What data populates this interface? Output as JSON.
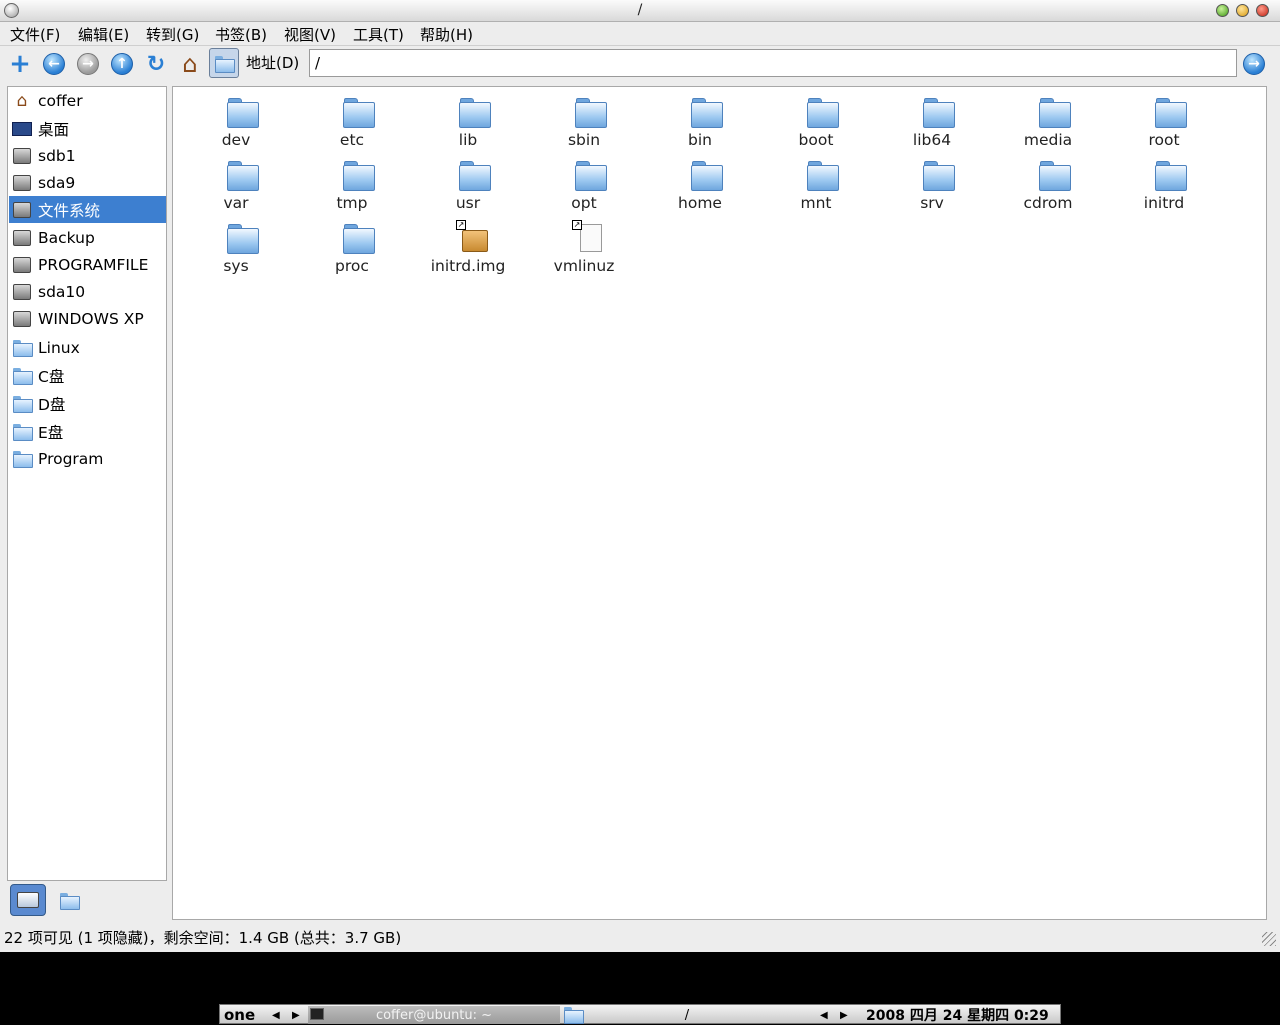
{
  "window": {
    "title": "/"
  },
  "menu": [
    "文件(F)",
    "编辑(E)",
    "转到(G)",
    "书签(B)",
    "视图(V)",
    "工具(T)",
    "帮助(H)"
  ],
  "toolbar": {
    "address_label": "地址(D)",
    "address_value": "/"
  },
  "sidebar": {
    "items": [
      {
        "label": "coffer",
        "icon": "home-icon"
      },
      {
        "label": "桌面",
        "icon": "desktop-icon"
      },
      {
        "label": "sdb1",
        "icon": "drive-icon"
      },
      {
        "label": "sda9",
        "icon": "drive-icon"
      },
      {
        "label": "文件系统",
        "icon": "drive-icon",
        "selected": true
      },
      {
        "label": "Backup",
        "icon": "drive-icon"
      },
      {
        "label": "PROGRAMFILE",
        "icon": "drive-icon"
      },
      {
        "label": "sda10",
        "icon": "drive-icon"
      },
      {
        "label": "WINDOWS XP",
        "icon": "drive-icon"
      },
      {
        "label": "Linux",
        "icon": "folder-icon"
      },
      {
        "label": "C盘",
        "icon": "folder-icon"
      },
      {
        "label": "D盘",
        "icon": "folder-icon"
      },
      {
        "label": "E盘",
        "icon": "folder-icon"
      },
      {
        "label": "Program",
        "icon": "folder-icon"
      }
    ]
  },
  "files": [
    {
      "name": "dev",
      "type": "folder"
    },
    {
      "name": "etc",
      "type": "folder"
    },
    {
      "name": "lib",
      "type": "folder"
    },
    {
      "name": "sbin",
      "type": "folder"
    },
    {
      "name": "bin",
      "type": "folder"
    },
    {
      "name": "boot",
      "type": "folder"
    },
    {
      "name": "lib64",
      "type": "folder"
    },
    {
      "name": "media",
      "type": "folder"
    },
    {
      "name": "root",
      "type": "folder"
    },
    {
      "name": "var",
      "type": "folder"
    },
    {
      "name": "tmp",
      "type": "folder"
    },
    {
      "name": "usr",
      "type": "folder"
    },
    {
      "name": "opt",
      "type": "folder"
    },
    {
      "name": "home",
      "type": "folder"
    },
    {
      "name": "mnt",
      "type": "folder"
    },
    {
      "name": "srv",
      "type": "folder"
    },
    {
      "name": "cdrom",
      "type": "folder"
    },
    {
      "name": "initrd",
      "type": "folder"
    },
    {
      "name": "sys",
      "type": "folder"
    },
    {
      "name": "proc",
      "type": "folder"
    },
    {
      "name": "initrd.img",
      "type": "package-link"
    },
    {
      "name": "vmlinuz",
      "type": "file-link"
    }
  ],
  "status": {
    "text": "22 项可见 (1 项隐藏)，剩余空间：1.4 GB (总共：3.7 GB)"
  },
  "taskbar": {
    "desktop_name": "one",
    "task1": "coffer@ubuntu: ~",
    "task2": "/",
    "clock": "2008 四月 24 星期四  0:29"
  },
  "colors": {
    "selection": "#3d7fd0",
    "folder": "#8cbdec"
  }
}
